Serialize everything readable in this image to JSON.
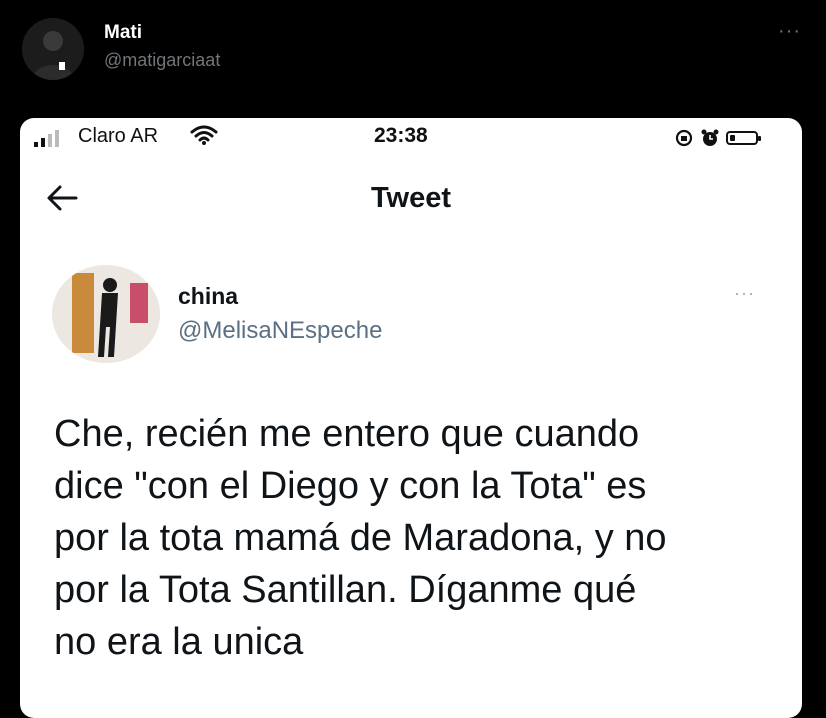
{
  "outer_tweet": {
    "author_name": "Mati",
    "author_handle": "@matigarciaat",
    "more_label": "···"
  },
  "status_bar": {
    "carrier": "Claro AR",
    "time": "23:38",
    "battery_level": 0.2
  },
  "nav": {
    "title": "Tweet"
  },
  "inner_tweet": {
    "author_name": "china",
    "author_handle": "@MelisaNEspeche",
    "more_label": "···",
    "text": "Che, recién me entero que cuando\ndice \"con el Diego y con la Tota\" es\npor la tota mamá de Maradona, y no\npor la Tota Santillan. Díganme qué\nno era la unica"
  },
  "icons": {
    "back": "arrow-left-icon",
    "wifi": "wifi-icon",
    "signal": "signal-icon",
    "orientation_lock": "orientation-lock-icon",
    "alarm": "alarm-icon",
    "battery": "battery-icon",
    "more": "more-horizontal-icon"
  }
}
